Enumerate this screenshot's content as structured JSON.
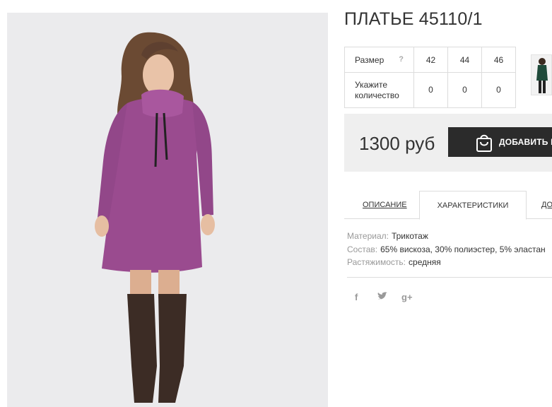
{
  "product": {
    "title": "ПЛАТЬЕ 45110/1",
    "image_description": "model wearing a lilac knit dress with cowl neck and brown over-the-knee boots"
  },
  "size_table": {
    "size_label": "Размер",
    "help_symbol": "?",
    "sizes": [
      "42",
      "44",
      "46"
    ],
    "qty_label_line1": "Укажите",
    "qty_label_line2": "количество",
    "quantities": [
      "0",
      "0",
      "0"
    ]
  },
  "price": "1300 руб",
  "cart_button": {
    "label": "ДОБАВИТЬ В",
    "icon": "shopping-bag-icon"
  },
  "tabs": [
    {
      "label": "ОПИСАНИЕ",
      "active": false
    },
    {
      "label": "ХАРАКТЕРИСТИКИ",
      "active": true
    },
    {
      "label": "ДО",
      "active": false
    }
  ],
  "specs": [
    {
      "key": "Материал:",
      "value": "Трикотаж"
    },
    {
      "key": "Состав:",
      "value": "65% вискоза, 30% полиэстер, 5% эластан"
    },
    {
      "key": "Растяжимость:",
      "value": "средняя"
    }
  ],
  "social": [
    {
      "label": "f",
      "icon": "facebook-icon"
    },
    {
      "label": "t",
      "icon": "twitter-icon"
    },
    {
      "label": "g+",
      "icon": "google-plus-icon"
    }
  ],
  "colors": {
    "photo_background": "#ebebed",
    "dress": "#9a4b8f",
    "boots": "#3c2c25",
    "button_background": "#2b2b2b",
    "buy_box_background": "#efefef"
  }
}
